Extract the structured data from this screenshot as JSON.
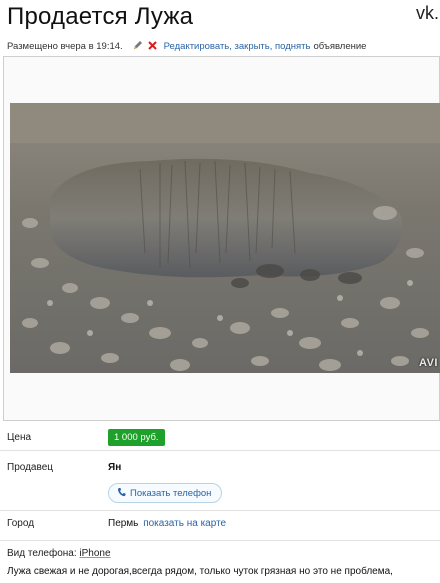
{
  "listing": {
    "title": "Продается Лужа",
    "watermark": "vk.",
    "posted": "Размещено вчера в 19:14.",
    "edit_link": "Редактировать, закрыть, поднять",
    "edit_suffix": "объявление",
    "photo_watermark": "AVI"
  },
  "details": {
    "price_label": "Цена",
    "price_value": "1 000 руб.",
    "seller_label": "Продавец",
    "seller_name": "Ян",
    "show_phone": "Показать телефон",
    "city_label": "Город",
    "city_value": "Пермь",
    "map_link": "показать на карте"
  },
  "extra": {
    "phone_type_label": "Вид телефона:",
    "phone_type_value": "iPhone",
    "description": "Лужа свежая и не дорогая,всегда рядом, только чуток грязная но это не проблема,"
  },
  "colors": {
    "link": "#2a64a8",
    "price_badge": "#1ea12a"
  },
  "icons": [
    "pencil-icon",
    "cross-icon",
    "phone-icon"
  ]
}
